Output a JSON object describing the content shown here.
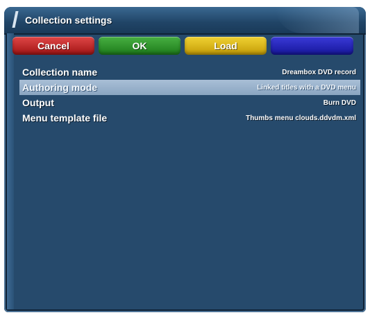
{
  "window": {
    "title": "Collection settings"
  },
  "buttons": {
    "red": "Cancel",
    "green": "OK",
    "yellow": "Load",
    "blue": ""
  },
  "colors": {
    "background": "#264a6c",
    "selection": "#9bb3cc",
    "red": "#c02626",
    "green": "#2e9a2a",
    "yellow": "#e0bb18",
    "blue": "#2626c2"
  },
  "settings": [
    {
      "label": "Collection name",
      "value": "Dreambox DVD record",
      "selected": false
    },
    {
      "label": "Authoring mode",
      "value": "Linked titles with a DVD menu",
      "selected": true
    },
    {
      "label": "Output",
      "value": "Burn DVD",
      "selected": false
    },
    {
      "label": "Menu template file",
      "value": "Thumbs menu clouds.ddvdm.xml",
      "selected": false
    }
  ]
}
